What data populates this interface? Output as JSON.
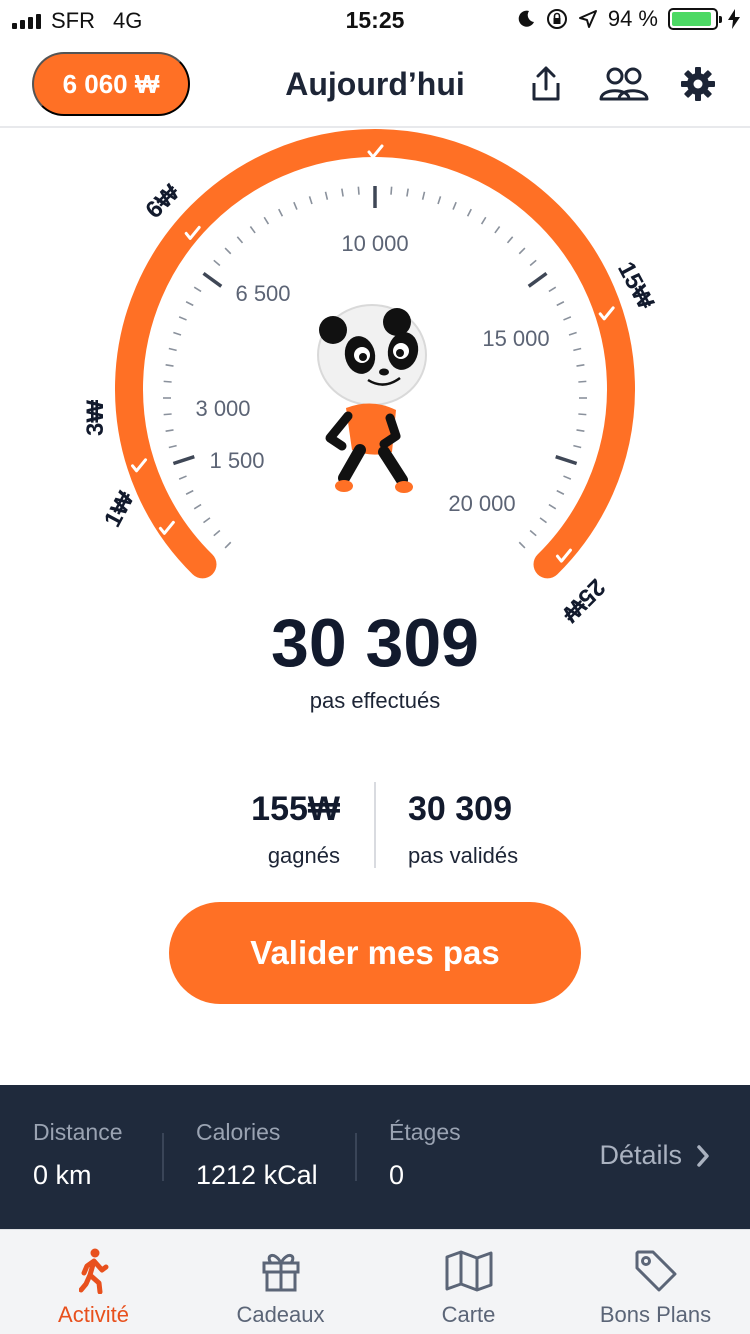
{
  "status_bar": {
    "carrier": "SFR",
    "network": "4G",
    "time": "15:25",
    "battery": "94 %",
    "battery_level": 0.94
  },
  "header": {
    "balance": "6 060 ₩",
    "title": "Aujourd’hui",
    "icons": [
      "share-icon",
      "friends-icon",
      "gear-icon"
    ]
  },
  "gauge": {
    "step_labels": [
      "1 500",
      "3 000",
      "6 500",
      "10 000",
      "15 000",
      "20 000"
    ],
    "reward_labels": [
      "1₩",
      "3₩",
      "6₩",
      "15₩",
      "25₩"
    ],
    "accent": "#ff7025"
  },
  "steps": {
    "count": "30 309",
    "label": "pas effectués"
  },
  "stats": {
    "earned_value": "155₩",
    "earned_label": "gagnés",
    "validated_value": "30 309",
    "validated_label": "pas validés"
  },
  "validate_button": "Valider mes pas",
  "metrics": {
    "distance_label": "Distance",
    "distance_value": "0 km",
    "calories_label": "Calories",
    "calories_value": "1212 kCal",
    "floors_label": "Étages",
    "floors_value": "0",
    "details_label": "Détails"
  },
  "tabs": [
    {
      "label": "Activité",
      "icon": "walking-icon",
      "active": true
    },
    {
      "label": "Cadeaux",
      "icon": "gift-icon",
      "active": false
    },
    {
      "label": "Carte",
      "icon": "map-icon",
      "active": false
    },
    {
      "label": "Bons Plans",
      "icon": "tag-icon",
      "active": false
    }
  ],
  "colors": {
    "accent": "#ff7025",
    "active_tab": "#e8501d",
    "panel": "#1f2a3c",
    "text_dark": "#121a2d"
  }
}
